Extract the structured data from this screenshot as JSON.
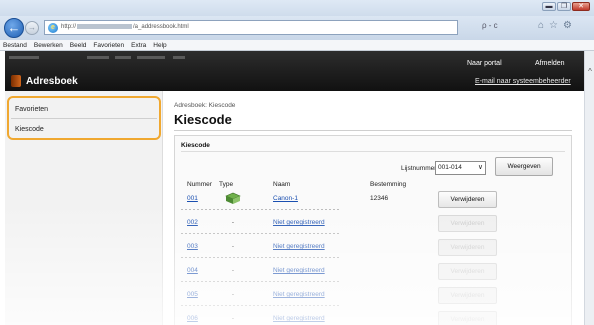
{
  "browser": {
    "url_prefix": "http://",
    "url_suffix": "/a_addressbook.html",
    "search_hint": "ρ - c",
    "window_min": "▬",
    "window_max": "❐",
    "window_close": "✕"
  },
  "menu": [
    "Bestand",
    "Bewerken",
    "Beeld",
    "Favorieten",
    "Extra",
    "Help"
  ],
  "header": {
    "title": "Adresboek",
    "portal_link": "Naar portal",
    "logout_link": "Afmelden",
    "mail_link": "E-mail naar systeembeheerder"
  },
  "sidebar": {
    "items": [
      {
        "label": "Favorieten"
      },
      {
        "label": "Kiescode"
      }
    ]
  },
  "main": {
    "breadcrumb": "Adresboek: Kiescode",
    "title": "Kiescode",
    "section_title": "Kiescode",
    "list_label": "Lijstnummer:",
    "list_value": "001-014",
    "show_button": "Weergeven",
    "columns": [
      "Nummer",
      "Type",
      "Naam",
      "Bestemming"
    ],
    "rows": [
      {
        "num": "001",
        "type": "book-icon",
        "name": "Canon-1",
        "dest": "12346",
        "action": "Verwijderen",
        "enabled": true
      },
      {
        "num": "002",
        "type": "-",
        "name": "Niet geregistreerd",
        "dest": "",
        "action": "Verwijderen",
        "enabled": false
      },
      {
        "num": "003",
        "type": "-",
        "name": "Niet geregistreerd",
        "dest": "",
        "action": "Verwijderen",
        "enabled": false
      },
      {
        "num": "004",
        "type": "-",
        "name": "Niet geregistreerd",
        "dest": "",
        "action": "Verwijderen",
        "enabled": false
      },
      {
        "num": "005",
        "type": "-",
        "name": "Niet geregistreerd",
        "dest": "",
        "action": "Verwijderen",
        "enabled": false
      },
      {
        "num": "006",
        "type": "-",
        "name": "Niet geregistreerd",
        "dest": "",
        "action": "Verwijderen",
        "enabled": false
      }
    ]
  },
  "colors": {
    "highlight": "#f0a830",
    "link": "#1a4fb0",
    "header_bg": "#1a1a1a"
  }
}
